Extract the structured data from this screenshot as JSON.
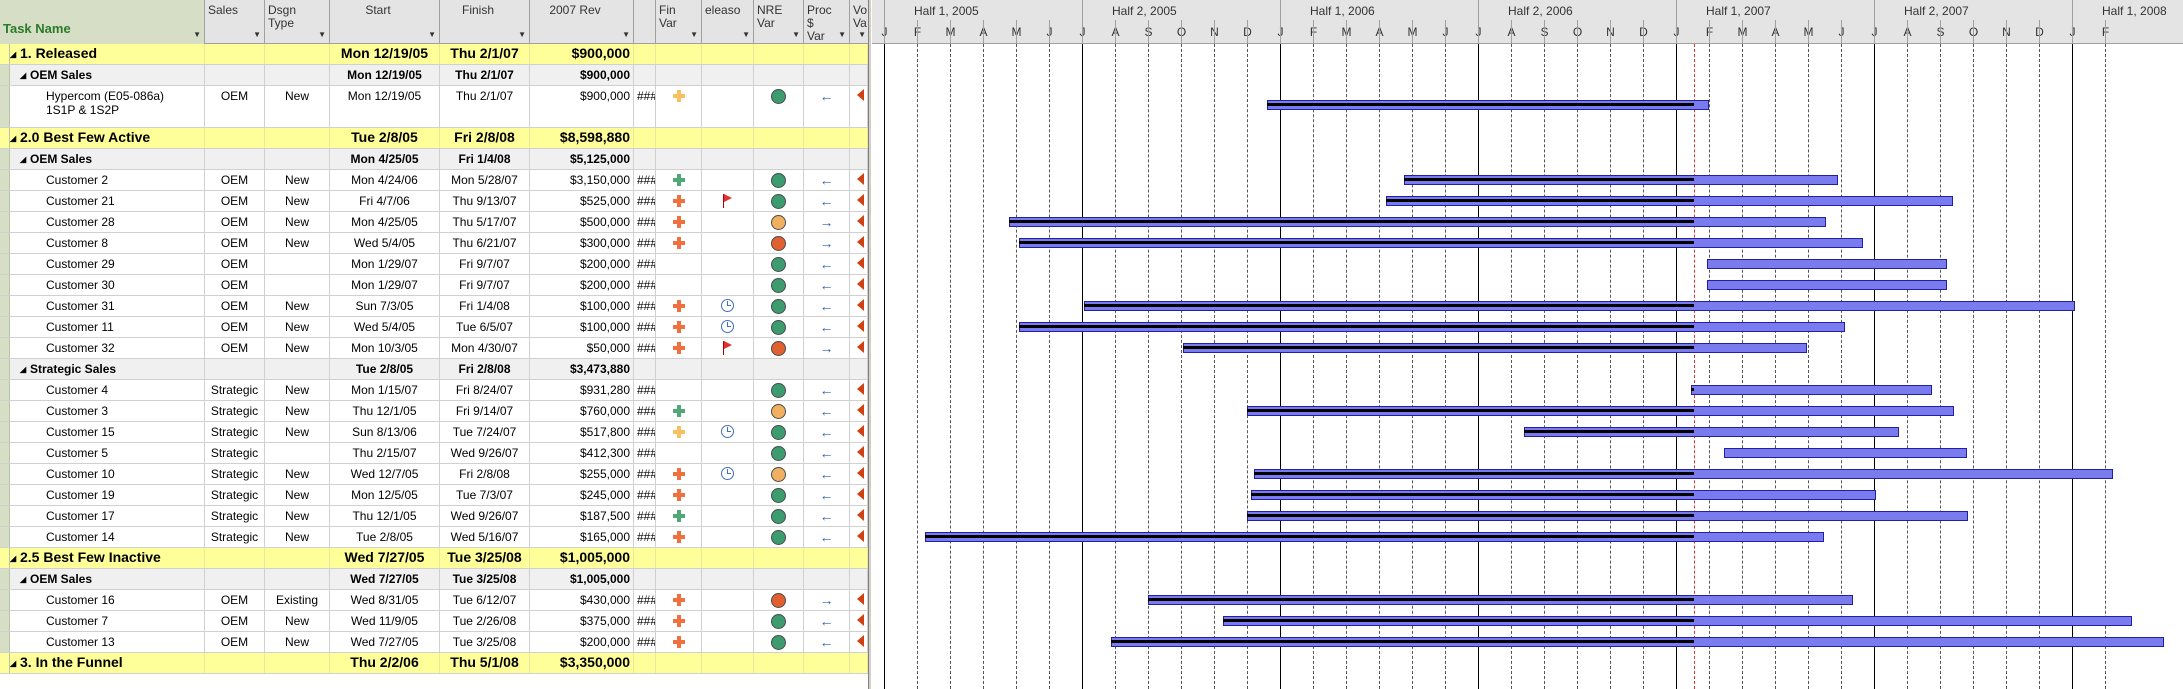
{
  "columns": {
    "task": "Task Name",
    "sales": "Sales",
    "dsgn": "Dsgn Type",
    "start": "Start",
    "finish": "Finish",
    "rev": "2007 Rev",
    "fin": "Fin Var",
    "release": "eleaso",
    "nre": "NRE Var",
    "proc": "Proc $ Var",
    "vol": "Vo Va"
  },
  "timescale": {
    "halves": [
      "Half 1, 2005",
      "Half 2, 2005",
      "Half 1, 2006",
      "Half 2, 2006",
      "Half 1, 2007",
      "Half 2, 2007",
      "Half 1, 2008"
    ],
    "months": [
      "J",
      "F",
      "M",
      "A",
      "M",
      "J",
      "J",
      "A",
      "S",
      "O",
      "N",
      "D",
      "J",
      "F",
      "M",
      "A",
      "M",
      "J",
      "J",
      "A",
      "S",
      "O",
      "N",
      "D",
      "J",
      "F",
      "M",
      "A",
      "M",
      "J",
      "J",
      "A",
      "S",
      "O",
      "N",
      "D",
      "J",
      "F"
    ]
  },
  "colors": {
    "plus_orange": "#f07040",
    "plus_green": "#50a878",
    "plus_light": "#f8c060",
    "dot_green": "#3c9c70",
    "dot_orange": "#f0b060",
    "dot_red": "#e06030",
    "bar_fill": "#7b7bf0"
  },
  "rows": [
    {
      "type": "group",
      "task": "1. Released",
      "start": "Mon 12/19/05",
      "finish": "Thu 2/1/07",
      "rev": "$900,000"
    },
    {
      "type": "sub",
      "task": "OEM Sales",
      "start": "Mon 12/19/05",
      "finish": "Thu 2/1/07",
      "rev": "$900,000"
    },
    {
      "type": "item",
      "task": "Hypercom (E05-086a)",
      "task2": "1S1P & 1S2P",
      "sales": "OEM",
      "dsgn": "New",
      "start": "Mon 12/19/05",
      "finish": "Thu 2/1/07",
      "rev": "$900,000",
      "hash": "###",
      "fin": "plus-light",
      "nre": "green",
      "proc": "←",
      "vol": "tri",
      "tall": true
    },
    {
      "type": "group",
      "task": "2.0  Best Few Active",
      "start": "Tue 2/8/05",
      "finish": "Fri 2/8/08",
      "rev": "$8,598,880"
    },
    {
      "type": "sub",
      "task": "OEM Sales",
      "start": "Mon 4/25/05",
      "finish": "Fri 1/4/08",
      "rev": "$5,125,000"
    },
    {
      "type": "item",
      "task": "Customer 2",
      "sales": "OEM",
      "dsgn": "New",
      "start": "Mon 4/24/06",
      "finish": "Mon 5/28/07",
      "rev": "$3,150,000",
      "hash": "###",
      "fin": "plus-green",
      "nre": "green",
      "proc": "←",
      "vol": "tri"
    },
    {
      "type": "item",
      "task": "Customer 21",
      "sales": "OEM",
      "dsgn": "New",
      "start": "Fri 4/7/06",
      "finish": "Thu 9/13/07",
      "rev": "$525,000",
      "hash": "###",
      "fin": "plus-orange",
      "rel": "flag",
      "nre": "green",
      "proc": "←",
      "vol": "tri"
    },
    {
      "type": "item",
      "task": "Customer 28",
      "sales": "OEM",
      "dsgn": "New",
      "start": "Mon 4/25/05",
      "finish": "Thu 5/17/07",
      "rev": "$500,000",
      "hash": "###",
      "fin": "plus-orange",
      "nre": "orange",
      "proc": "→",
      "vol": "tri"
    },
    {
      "type": "item",
      "task": "Customer 8",
      "sales": "OEM",
      "dsgn": "New",
      "start": "Wed 5/4/05",
      "finish": "Thu 6/21/07",
      "rev": "$300,000",
      "hash": "###",
      "fin": "plus-orange",
      "nre": "red",
      "proc": "→",
      "vol": "tri"
    },
    {
      "type": "item",
      "task": "Customer 29",
      "sales": "OEM",
      "dsgn": "",
      "start": "Mon 1/29/07",
      "finish": "Fri 9/7/07",
      "rev": "$200,000",
      "hash": "###",
      "nre": "green",
      "proc": "←",
      "vol": "tri"
    },
    {
      "type": "item",
      "task": "Customer 30",
      "sales": "OEM",
      "dsgn": "",
      "start": "Mon 1/29/07",
      "finish": "Fri 9/7/07",
      "rev": "$200,000",
      "hash": "###",
      "nre": "green",
      "proc": "←",
      "vol": "tri"
    },
    {
      "type": "item",
      "task": "Customer 31",
      "sales": "OEM",
      "dsgn": "New",
      "start": "Sun 7/3/05",
      "finish": "Fri 1/4/08",
      "rev": "$100,000",
      "hash": "###",
      "fin": "plus-orange",
      "rel": "clock",
      "nre": "green",
      "proc": "←",
      "vol": "tri"
    },
    {
      "type": "item",
      "task": "Customer 11",
      "sales": "OEM",
      "dsgn": "New",
      "start": "Wed 5/4/05",
      "finish": "Tue 6/5/07",
      "rev": "$100,000",
      "hash": "###",
      "fin": "plus-orange",
      "rel": "clock",
      "nre": "green",
      "proc": "←",
      "vol": "tri"
    },
    {
      "type": "item",
      "task": "Customer 32",
      "sales": "OEM",
      "dsgn": "New",
      "start": "Mon 10/3/05",
      "finish": "Mon 4/30/07",
      "rev": "$50,000",
      "hash": "###",
      "fin": "plus-orange",
      "rel": "flag",
      "nre": "red",
      "proc": "→",
      "vol": "tri"
    },
    {
      "type": "sub",
      "task": "Strategic Sales",
      "start": "Tue 2/8/05",
      "finish": "Fri 2/8/08",
      "rev": "$3,473,880"
    },
    {
      "type": "item",
      "task": "Customer 4",
      "sales": "Strategic",
      "dsgn": "New",
      "start": "Mon 1/15/07",
      "finish": "Fri 8/24/07",
      "rev": "$931,280",
      "hash": "###",
      "nre": "green",
      "proc": "←",
      "vol": "tri"
    },
    {
      "type": "item",
      "task": "Customer 3",
      "sales": "Strategic",
      "dsgn": "New",
      "start": "Thu 12/1/05",
      "finish": "Fri 9/14/07",
      "rev": "$760,000",
      "hash": "###",
      "fin": "plus-green",
      "nre": "orange",
      "proc": "←",
      "vol": "tri"
    },
    {
      "type": "item",
      "task": "Customer 15",
      "sales": "Strategic",
      "dsgn": "New",
      "start": "Sun 8/13/06",
      "finish": "Tue 7/24/07",
      "rev": "$517,800",
      "hash": "###",
      "fin": "plus-light",
      "rel": "clock",
      "nre": "green",
      "proc": "←",
      "vol": "tri"
    },
    {
      "type": "item",
      "task": "Customer 5",
      "sales": "Strategic",
      "dsgn": "",
      "start": "Thu 2/15/07",
      "finish": "Wed 9/26/07",
      "rev": "$412,300",
      "hash": "###",
      "nre": "green",
      "proc": "←",
      "vol": "tri"
    },
    {
      "type": "item",
      "task": "Customer 10",
      "sales": "Strategic",
      "dsgn": "New",
      "start": "Wed 12/7/05",
      "finish": "Fri 2/8/08",
      "rev": "$255,000",
      "hash": "###",
      "fin": "plus-orange",
      "rel": "clock",
      "nre": "orange",
      "proc": "←",
      "vol": "tri"
    },
    {
      "type": "item",
      "task": "Customer 19",
      "sales": "Strategic",
      "dsgn": "New",
      "start": "Mon 12/5/05",
      "finish": "Tue 7/3/07",
      "rev": "$245,000",
      "hash": "###",
      "fin": "plus-orange",
      "nre": "green",
      "proc": "←",
      "vol": "tri"
    },
    {
      "type": "item",
      "task": "Customer 17",
      "sales": "Strategic",
      "dsgn": "New",
      "start": "Thu 12/1/05",
      "finish": "Wed 9/26/07",
      "rev": "$187,500",
      "hash": "###",
      "fin": "plus-green",
      "nre": "green",
      "proc": "←",
      "vol": "tri"
    },
    {
      "type": "item",
      "task": "Customer 14",
      "sales": "Strategic",
      "dsgn": "New",
      "start": "Tue 2/8/05",
      "finish": "Wed 5/16/07",
      "rev": "$165,000",
      "hash": "###",
      "fin": "plus-orange",
      "nre": "green",
      "proc": "←",
      "vol": "tri"
    },
    {
      "type": "group",
      "task": "2.5 Best Few Inactive",
      "start": "Wed 7/27/05",
      "finish": "Tue 3/25/08",
      "rev": "$1,005,000"
    },
    {
      "type": "sub",
      "task": "OEM Sales",
      "start": "Wed 7/27/05",
      "finish": "Tue 3/25/08",
      "rev": "$1,005,000"
    },
    {
      "type": "item",
      "task": "Customer 16",
      "sales": "OEM",
      "dsgn": "Existing",
      "start": "Wed 8/31/05",
      "finish": "Tue 6/12/07",
      "rev": "$430,000",
      "hash": "###",
      "fin": "plus-orange",
      "nre": "red",
      "proc": "→",
      "vol": "tri"
    },
    {
      "type": "item",
      "task": "Customer 7",
      "sales": "OEM",
      "dsgn": "New",
      "start": "Wed 11/9/05",
      "finish": "Tue 2/26/08",
      "rev": "$375,000",
      "hash": "###",
      "fin": "plus-orange",
      "nre": "green",
      "proc": "←",
      "vol": "tri"
    },
    {
      "type": "item",
      "task": "Customer 13",
      "sales": "OEM",
      "dsgn": "New",
      "start": "Wed 7/27/05",
      "finish": "Tue 3/25/08",
      "rev": "$200,000",
      "hash": "###",
      "fin": "plus-orange",
      "nre": "green",
      "proc": "←",
      "vol": "tri"
    },
    {
      "type": "group",
      "task": "3. In the Funnel",
      "start": "Thu 2/2/06",
      "finish": "Thu 5/1/08",
      "rev": "$3,350,000"
    }
  ]
}
